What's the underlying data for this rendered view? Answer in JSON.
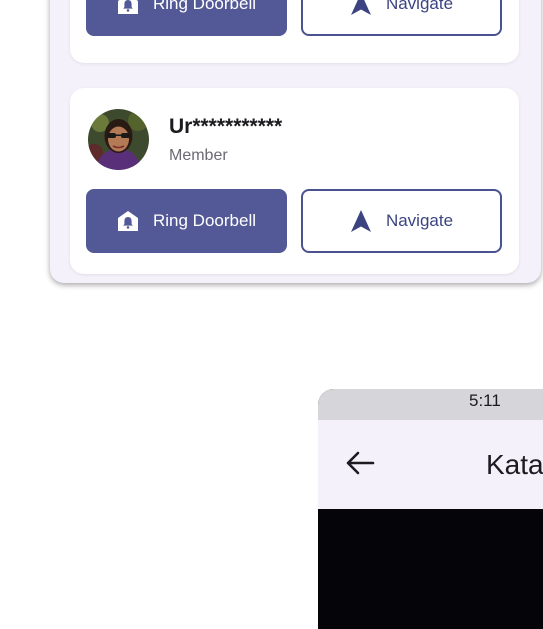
{
  "cards": [
    {
      "name": "",
      "role": "",
      "ring_label": "Ring Doorbell",
      "navigate_label": "Navigate"
    },
    {
      "name": "Ur***********",
      "role": "Member",
      "ring_label": "Ring Doorbell",
      "navigate_label": "Navigate"
    }
  ],
  "icons": {
    "ring": "doorbell-icon",
    "navigate": "navigation-arrow-icon",
    "back": "back-arrow-icon"
  },
  "colors": {
    "primary": "#535996",
    "panel_bg": "#f5f1fa",
    "outline": "#4a5290"
  },
  "phone2": {
    "status_time": "5:11",
    "title": "Kata"
  }
}
